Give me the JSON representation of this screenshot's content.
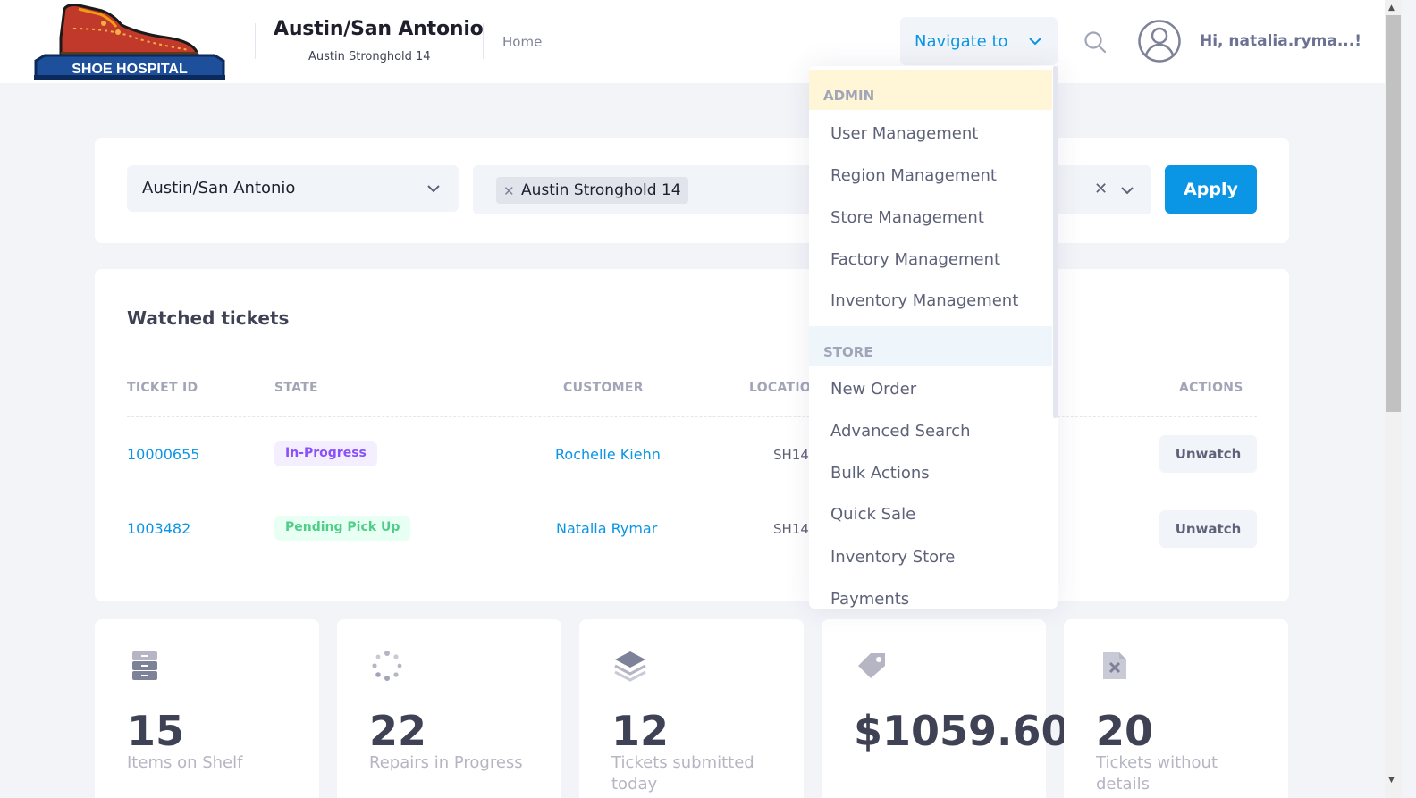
{
  "brand": {
    "logo_text": "SHOE HOSPITAL"
  },
  "header": {
    "region_title": "Austin/San Antonio",
    "region_subtitle": "Austin Stronghold 14",
    "home_link": "Home",
    "navigate_label": "Navigate to",
    "greeting": "Hi, natalia.ryma...!"
  },
  "filters": {
    "region_value": "Austin/San Antonio",
    "store_chip": "Austin Stronghold 14",
    "apply_label": "Apply"
  },
  "tickets": {
    "title": "Watched tickets",
    "columns": [
      "TICKET ID",
      "STATE",
      "CUSTOMER",
      "LOCATIO",
      "ACTIONS"
    ],
    "rows": [
      {
        "id": "10000655",
        "state": "In-Progress",
        "customer": "Rochelle Kiehn",
        "location": "SH14",
        "action": "Unwatch"
      },
      {
        "id": "1003482",
        "state": "Pending Pick Up",
        "customer": "Natalia Rymar",
        "location": "SH14",
        "action": "Unwatch"
      }
    ]
  },
  "stats": [
    {
      "value": "15",
      "label": "Items on Shelf",
      "icon": "archive-icon"
    },
    {
      "value": "22",
      "label": "Repairs in Progress",
      "icon": "spinner-icon"
    },
    {
      "value": "12",
      "label": "Tickets submitted today",
      "icon": "layers-icon"
    },
    {
      "value": "$1059.60",
      "label": "",
      "icon": "tag-icon"
    },
    {
      "value": "20",
      "label": "Tickets without details",
      "icon": "file-x-icon"
    }
  ],
  "navigate_menu": {
    "admin_header": "ADMIN",
    "admin_items": [
      "User Management",
      "Region Management",
      "Store Management",
      "Factory Management",
      "Inventory Management"
    ],
    "store_header": "STORE",
    "store_items": [
      "New Order",
      "Advanced Search",
      "Bulk Actions",
      "Quick Sale",
      "Inventory Store",
      "Payments"
    ]
  },
  "colors": {
    "primary": "#0a95e5",
    "page_bg": "#f2f4f8",
    "in_progress": "#8950fc",
    "pending": "#50cd89",
    "admin_section_bg": "#fff6d8",
    "store_section_bg": "#eef6fc"
  }
}
